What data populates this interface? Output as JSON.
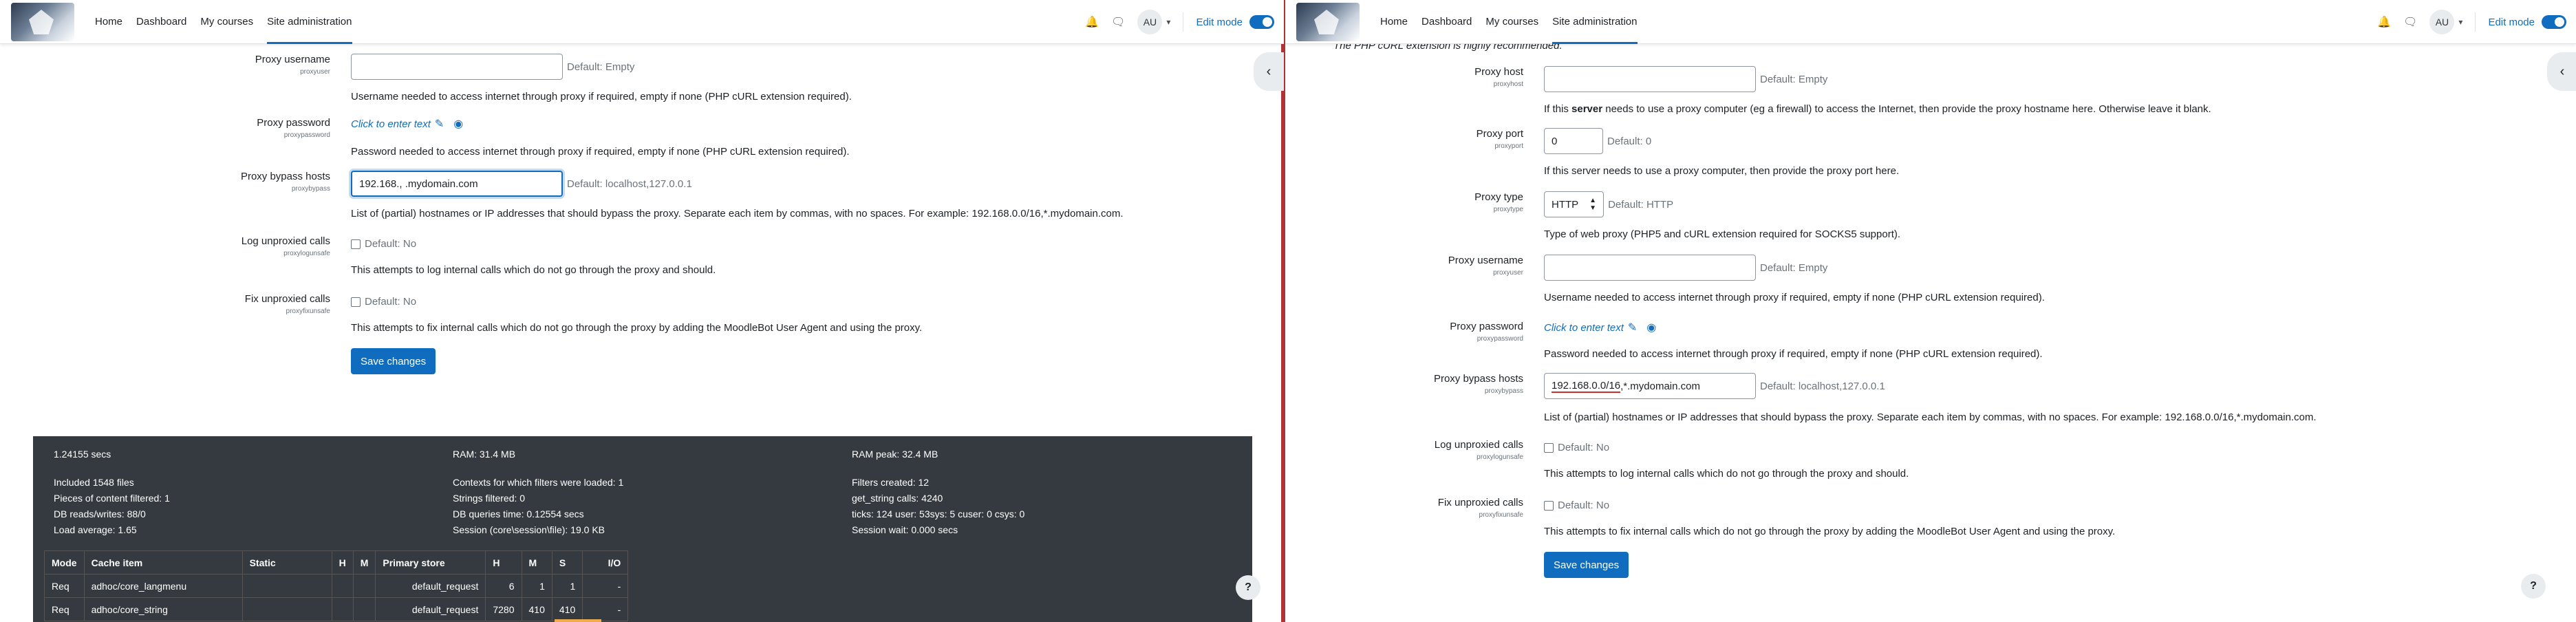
{
  "nav": {
    "links": [
      "Home",
      "Dashboard",
      "My courses",
      "Site administration"
    ],
    "avatar": "AU",
    "edit_mode": "Edit mode"
  },
  "left": {
    "proxy_username": {
      "label": "Proxy username",
      "sub": "proxyuser",
      "value": "",
      "default": "Default: Empty",
      "desc": "Username needed to access internet through proxy if required, empty if none (PHP cURL extension required)."
    },
    "proxy_password": {
      "label": "Proxy password",
      "sub": "proxypassword",
      "link": "Click to enter text",
      "desc": "Password needed to access internet through proxy if required, empty if none (PHP cURL extension required)."
    },
    "proxy_bypass": {
      "label": "Proxy bypass hosts",
      "sub": "proxybypass",
      "value": "192.168., .mydomain.com",
      "default": "Default: localhost,127.0.0.1",
      "desc": "List of (partial) hostnames or IP addresses that should bypass the proxy. Separate each item by commas, with no spaces. For example: 192.168.0.0/16,*.mydomain.com."
    },
    "log_unproxied": {
      "label": "Log unproxied calls",
      "sub": "proxylogunsafe",
      "default": "Default: No",
      "desc": "This attempts to log internal calls which do not go through the proxy and should."
    },
    "fix_unproxied": {
      "label": "Fix unproxied calls",
      "sub": "proxyfixunsafe",
      "default": "Default: No",
      "desc": "This attempts to fix internal calls which do not go through the proxy by adding the MoodleBot User Agent and using the proxy."
    },
    "save": "Save changes"
  },
  "perf": {
    "secs": "1.24155 secs",
    "ram": "RAM: 31.4 MB",
    "ram_peak": "RAM peak: 32.4 MB",
    "col1": [
      "Included 1548 files",
      "Pieces of content filtered: 1",
      "DB reads/writes: 88/0",
      "Load average: 1.65"
    ],
    "col2": [
      "Contexts for which filters were loaded: 1",
      "Strings filtered: 0",
      "DB queries time: 0.12554 secs",
      "Session (core\\session\\file): 19.0 KB"
    ],
    "col3": [
      "Filters created: 12",
      "get_string calls: 4240",
      "ticks: 124 user: 53sys: 5 cuser: 0 csys: 0",
      "Session wait: 0.000 secs"
    ],
    "table": {
      "headers": [
        "Mode",
        "Cache item",
        "Static",
        "H",
        "M",
        "Primary store",
        "H",
        "M",
        "S",
        "I/O"
      ],
      "rows": [
        [
          "Req",
          "adhoc/core_langmenu",
          "",
          "",
          "",
          "default_request",
          "6",
          "1",
          "1",
          "-"
        ],
        [
          "Req",
          "adhoc/core_string",
          "",
          "",
          "",
          "default_request",
          "7280",
          "410",
          "410",
          "-"
        ]
      ]
    }
  },
  "right": {
    "top_note": "The PHP cURL extension is highly recommended.",
    "proxy_host": {
      "label": "Proxy host",
      "sub": "proxyhost",
      "value": "",
      "default": "Default: Empty",
      "desc_pre": "If this ",
      "desc_bold": "server",
      "desc_post": " needs to use a proxy computer (eg a firewall) to access the Internet, then provide the proxy hostname here. Otherwise leave it blank."
    },
    "proxy_port": {
      "label": "Proxy port",
      "sub": "proxyport",
      "value": "0",
      "default": "Default: 0",
      "desc": "If this server needs to use a proxy computer, then provide the proxy port here."
    },
    "proxy_type": {
      "label": "Proxy type",
      "sub": "proxytype",
      "value": "HTTP",
      "default": "Default: HTTP",
      "desc": "Type of web proxy (PHP5 and cURL extension required for SOCKS5 support)."
    },
    "proxy_username": {
      "label": "Proxy username",
      "sub": "proxyuser",
      "value": "",
      "default": "Default: Empty",
      "desc": "Username needed to access internet through proxy if required, empty if none (PHP cURL extension required)."
    },
    "proxy_password": {
      "label": "Proxy password",
      "sub": "proxypassword",
      "link": "Click to enter text",
      "desc": "Password needed to access internet through proxy if required, empty if none (PHP cURL extension required)."
    },
    "proxy_bypass": {
      "label": "Proxy bypass hosts",
      "sub": "proxybypass",
      "value_a": "192.168.0.0/16",
      "value_b": ",*.mydomain.com",
      "default": "Default: localhost,127.0.0.1",
      "desc": "List of (partial) hostnames or IP addresses that should bypass the proxy. Separate each item by commas, with no spaces. For example: 192.168.0.0/16,*.mydomain.com."
    },
    "log_unproxied": {
      "label": "Log unproxied calls",
      "sub": "proxylogunsafe",
      "default": "Default: No",
      "desc": "This attempts to log internal calls which do not go through the proxy and should."
    },
    "fix_unproxied": {
      "label": "Fix unproxied calls",
      "sub": "proxyfixunsafe",
      "default": "Default: No",
      "desc": "This attempts to fix internal calls which do not go through the proxy by adding the MoodleBot User Agent and using the proxy."
    },
    "save": "Save changes"
  },
  "colors": {
    "primary": "#0f6cbf",
    "footer_bg": "#343a40"
  },
  "icons": [
    "bell-icon",
    "chat-icon",
    "chevron-down-icon",
    "pencil-icon",
    "eye-icon",
    "chevron-left-icon",
    "question-icon"
  ]
}
